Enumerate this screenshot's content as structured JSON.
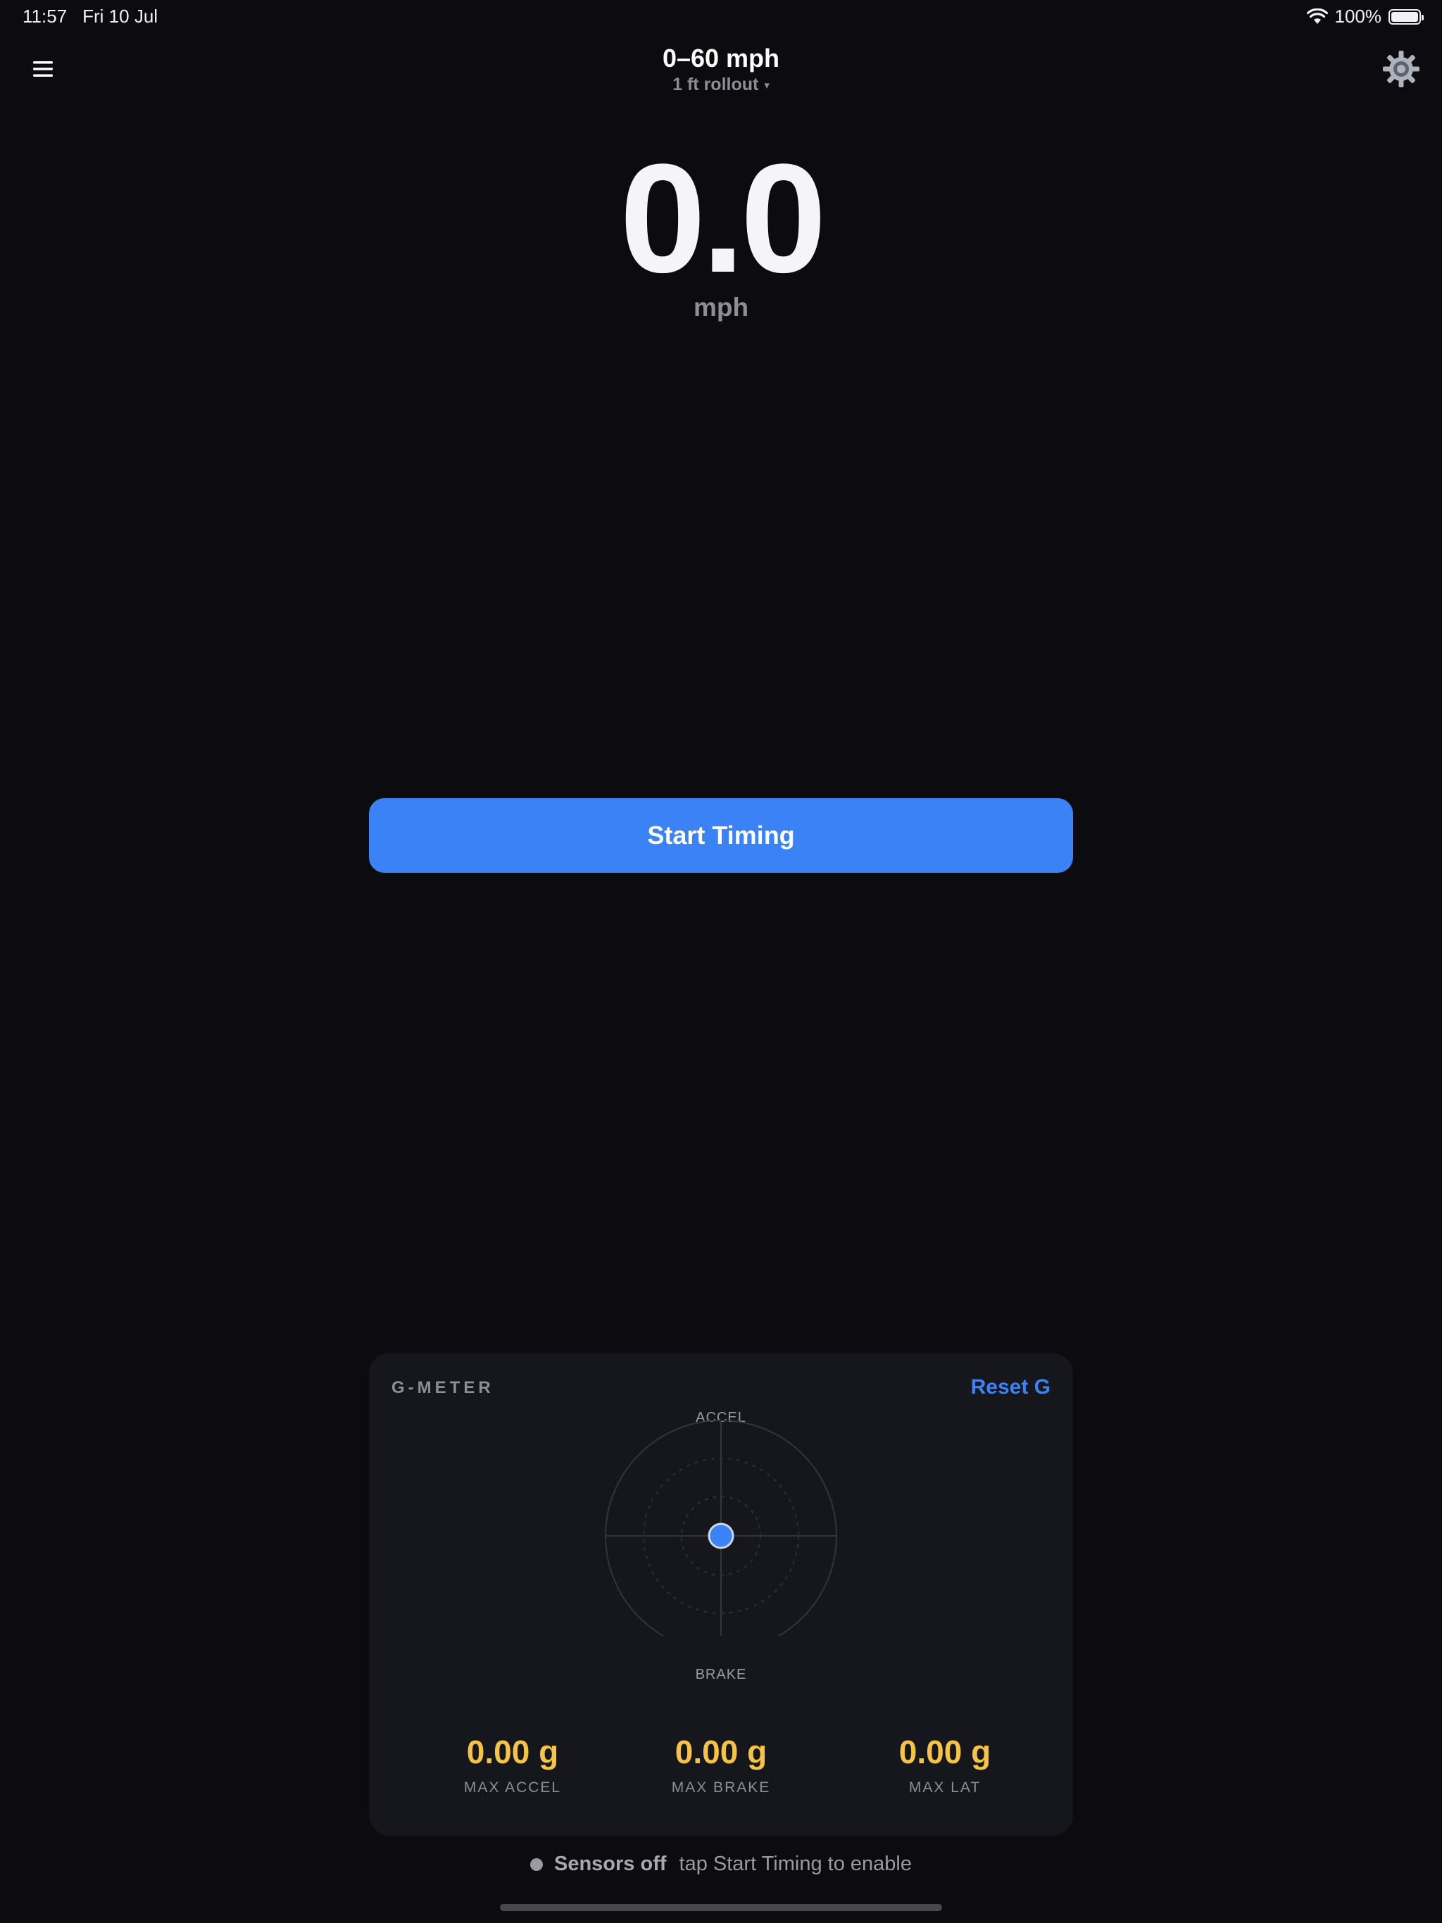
{
  "status_bar": {
    "time": "11:57",
    "date": "Fri 10 Jul",
    "battery": "100%",
    "icons": [
      "wifi-icon",
      "battery-icon"
    ]
  },
  "header": {
    "title": "0–60 mph",
    "rollout": "1 ft rollout",
    "rollout_caret": "▾",
    "icons": [
      "menu-icon",
      "gear-icon"
    ]
  },
  "speedometer": {
    "value": "0.0",
    "unit": "mph"
  },
  "start_button": {
    "label": "Start Timing"
  },
  "gmeter": {
    "title": "G-METER",
    "reset_label": "Reset G",
    "top_label": "ACCEL",
    "bottom_label": "BRAKE",
    "dot_position": {
      "lateral_g": 0.0,
      "longitudinal_g": 0.0
    },
    "stats": [
      {
        "value": "0.00 g",
        "label": "MAX ACCEL"
      },
      {
        "value": "0.00 g",
        "label": "MAX BRAKE"
      },
      {
        "value": "0.00 g",
        "label": "MAX LAT"
      }
    ]
  },
  "sensors": {
    "state": "Sensors off",
    "hint": "tap Start Timing to enable"
  },
  "colors": {
    "background": "#0b0b10",
    "card": "#16171c",
    "accent": "#3b82f6",
    "stat": "#f6c343",
    "muted": "#8e8e96"
  }
}
